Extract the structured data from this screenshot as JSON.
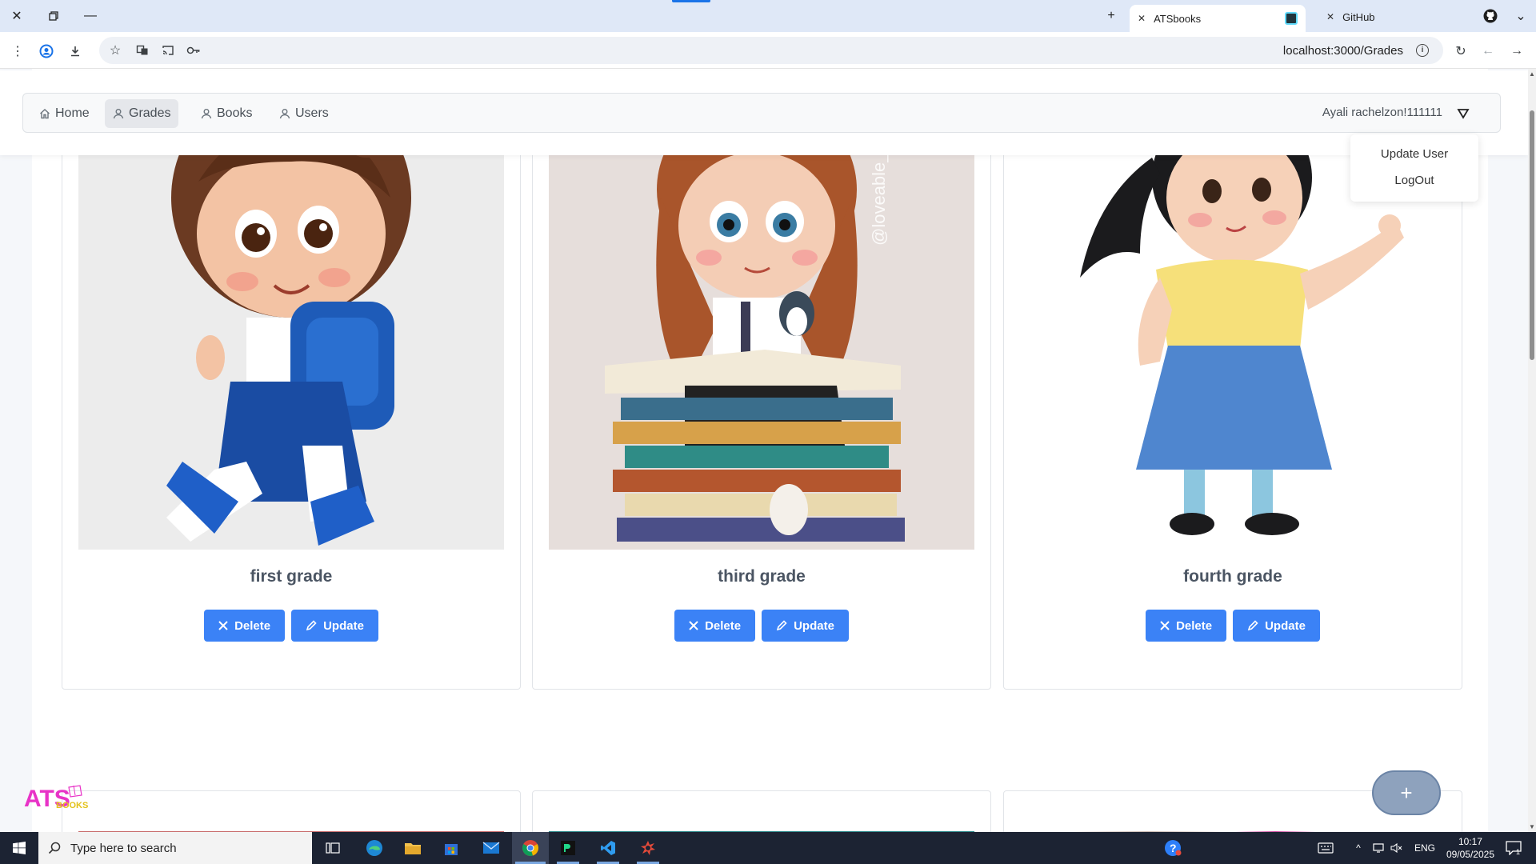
{
  "browser": {
    "tabs": [
      {
        "label": "ATSbooks",
        "active": true
      },
      {
        "label": "GitHub",
        "active": false
      }
    ],
    "url": "localhost:3000/Grades"
  },
  "nav": {
    "items": [
      {
        "label": "Home",
        "icon": "home-icon",
        "active": false
      },
      {
        "label": "Grades",
        "icon": "user-icon",
        "active": true
      },
      {
        "label": "Books",
        "icon": "user-icon",
        "active": false
      },
      {
        "label": "Users",
        "icon": "user-icon",
        "active": false
      }
    ],
    "user_name": "Ayali rachelzon!111111"
  },
  "user_menu": {
    "items": [
      "Update User",
      "LogOut"
    ]
  },
  "grades": [
    {
      "title": "first grade",
      "image": "girl-with-blue-backpack",
      "delete_label": "Delete",
      "update_label": "Update"
    },
    {
      "title": "third grade",
      "image": "girl-on-books-with-penguins",
      "delete_label": "Delete",
      "update_label": "Update"
    },
    {
      "title": "fourth grade",
      "image": "girl-pointing",
      "delete_label": "Delete",
      "update_label": "Update"
    }
  ],
  "image_watermark": "@loveable_aiart",
  "fab_label": "+",
  "logo": {
    "text_main": "ATS",
    "text_sub": "BOOKS"
  },
  "taskbar": {
    "search_placeholder": "Type here to search",
    "language": "ENG",
    "time": "10:17",
    "date": "09/05/2025",
    "notifications": "1"
  },
  "colors": {
    "primary_button": "#3b82f6",
    "fab": "#8ea2bd",
    "tabstrip": "#dfe8f7",
    "taskbar": "#1c2333"
  }
}
